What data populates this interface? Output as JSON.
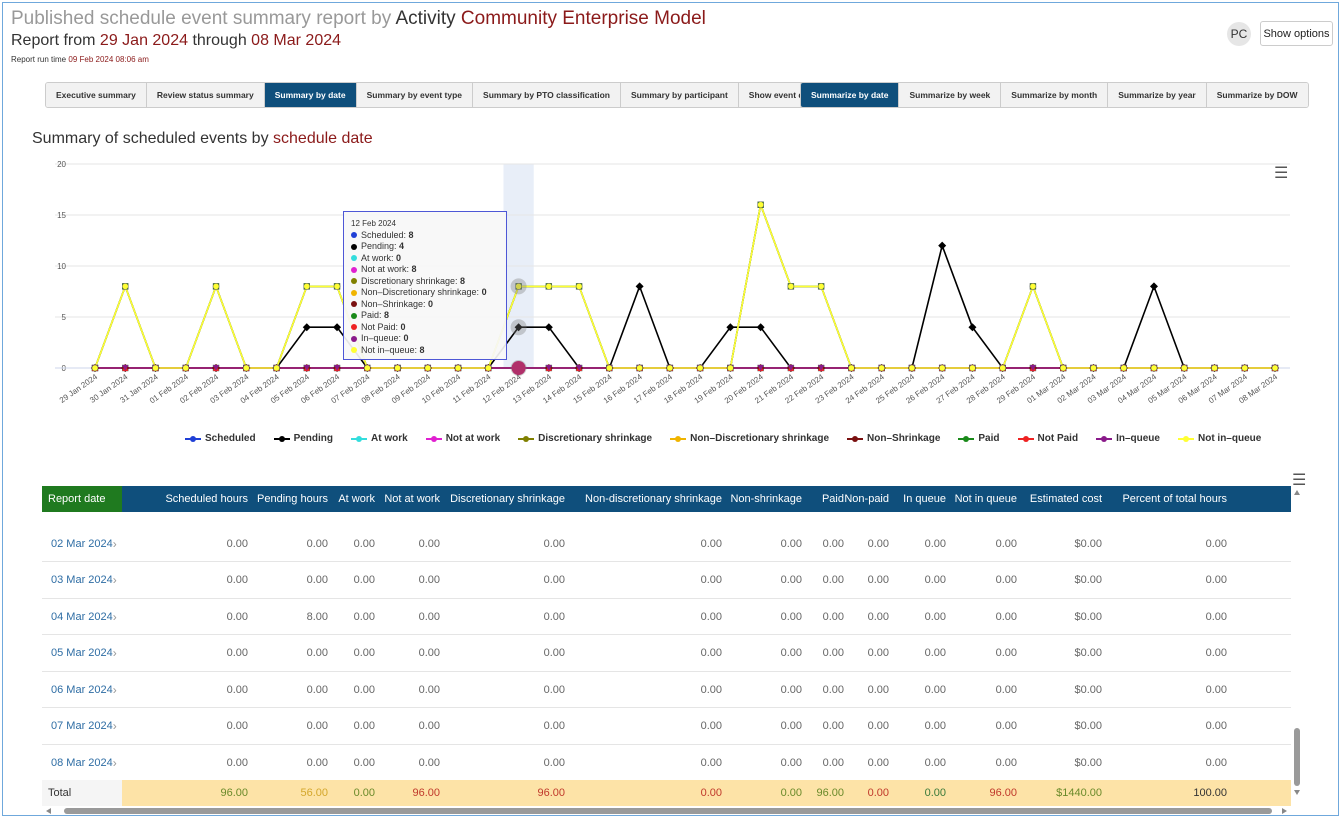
{
  "header": {
    "title_prefix": "Published schedule event summary report by",
    "title_mid": "Activity",
    "title_entity": "Community Enterprise Model",
    "sub_prefix": "Report from",
    "date_from": "29 Jan 2024",
    "sub_mid": "through",
    "date_to": "08 Mar 2024",
    "run_label": "Report run time",
    "run_time": "09 Feb 2024 08:06 am",
    "avatar": "PC",
    "show_options": "Show options"
  },
  "tabs_left": [
    {
      "label": "Executive summary",
      "active": false
    },
    {
      "label": "Review status summary",
      "active": false
    },
    {
      "label": "Summary by date",
      "active": true
    },
    {
      "label": "Summary by event type",
      "active": false
    },
    {
      "label": "Summary by PTO classification",
      "active": false
    },
    {
      "label": "Summary by participant",
      "active": false
    },
    {
      "label": "Show event details",
      "active": false
    }
  ],
  "tabs_right": [
    {
      "label": "Summarize by date",
      "active": true
    },
    {
      "label": "Summarize by week",
      "active": false
    },
    {
      "label": "Summarize by month",
      "active": false
    },
    {
      "label": "Summarize by year",
      "active": false
    },
    {
      "label": "Summarize by DOW",
      "active": false
    }
  ],
  "chart_title_prefix": "Summary of scheduled events by",
  "chart_title_key": "schedule date",
  "chart_data": {
    "type": "line",
    "x": [
      "29 Jan 2024",
      "30 Jan 2024",
      "31 Jan 2024",
      "01 Feb 2024",
      "02 Feb 2024",
      "03 Feb 2024",
      "04 Feb 2024",
      "05 Feb 2024",
      "06 Feb 2024",
      "07 Feb 2024",
      "08 Feb 2024",
      "09 Feb 2024",
      "10 Feb 2024",
      "11 Feb 2024",
      "12 Feb 2024",
      "13 Feb 2024",
      "14 Feb 2024",
      "15 Feb 2024",
      "16 Feb 2024",
      "17 Feb 2024",
      "18 Feb 2024",
      "19 Feb 2024",
      "20 Feb 2024",
      "21 Feb 2024",
      "22 Feb 2024",
      "23 Feb 2024",
      "24 Feb 2024",
      "25 Feb 2024",
      "26 Feb 2024",
      "27 Feb 2024",
      "28 Feb 2024",
      "29 Feb 2024",
      "01 Mar 2024",
      "02 Mar 2024",
      "03 Mar 2024",
      "04 Mar 2024",
      "05 Mar 2024",
      "06 Mar 2024",
      "07 Mar 2024",
      "08 Mar 2024"
    ],
    "ylim": [
      0,
      20
    ],
    "yticks": [
      0,
      5,
      10,
      15,
      20
    ],
    "grid": true,
    "legend_position": "bottom",
    "series": [
      {
        "name": "Scheduled",
        "color": "#1f3fd6",
        "marker": "circle",
        "values": [
          0,
          0,
          0,
          0,
          0,
          0,
          0,
          0,
          0,
          0,
          0,
          0,
          0,
          0,
          0,
          0,
          0,
          0,
          0,
          0,
          0,
          0,
          0,
          0,
          0,
          0,
          0,
          0,
          0,
          0,
          0,
          0,
          0,
          0,
          0,
          0,
          0,
          0,
          0,
          0
        ]
      },
      {
        "name": "Pending",
        "color": "#000000",
        "marker": "diamond",
        "values": [
          0,
          0,
          0,
          0,
          0,
          0,
          0,
          4,
          4,
          0,
          0,
          0,
          0,
          0,
          4,
          4,
          0,
          0,
          8,
          0,
          0,
          4,
          4,
          0,
          0,
          0,
          0,
          0,
          12,
          4,
          0,
          0,
          0,
          0,
          0,
          8,
          0,
          0,
          0,
          0
        ]
      },
      {
        "name": "At work",
        "color": "#33dddd",
        "marker": "square",
        "values": [
          0,
          0,
          0,
          0,
          0,
          0,
          0,
          0,
          0,
          0,
          0,
          0,
          0,
          0,
          0,
          0,
          0,
          0,
          0,
          0,
          0,
          0,
          0,
          0,
          0,
          0,
          0,
          0,
          0,
          0,
          0,
          0,
          0,
          0,
          0,
          0,
          0,
          0,
          0,
          0
        ]
      },
      {
        "name": "Not at work",
        "color": "#e020d0",
        "marker": "triangle",
        "values": [
          0,
          8,
          0,
          0,
          8,
          0,
          0,
          8,
          8,
          0,
          0,
          0,
          0,
          0,
          8,
          8,
          8,
          0,
          0,
          0,
          0,
          0,
          16,
          8,
          8,
          0,
          0,
          0,
          0,
          0,
          0,
          8,
          0,
          0,
          0,
          0,
          0,
          0,
          0,
          0
        ]
      },
      {
        "name": "Discretionary shrinkage",
        "color": "#808000",
        "marker": "triangle-down",
        "values": [
          0,
          8,
          0,
          0,
          8,
          0,
          0,
          8,
          8,
          0,
          0,
          0,
          0,
          0,
          8,
          8,
          8,
          0,
          0,
          0,
          0,
          0,
          16,
          8,
          8,
          0,
          0,
          0,
          0,
          0,
          0,
          8,
          0,
          0,
          0,
          0,
          0,
          0,
          0,
          0
        ]
      },
      {
        "name": "Non–Discretionary shrinkage",
        "color": "#f0b400",
        "marker": "circle",
        "values": [
          0,
          0,
          0,
          0,
          0,
          0,
          0,
          0,
          0,
          0,
          0,
          0,
          0,
          0,
          0,
          0,
          0,
          0,
          0,
          0,
          0,
          0,
          0,
          0,
          0,
          0,
          0,
          0,
          0,
          0,
          0,
          0,
          0,
          0,
          0,
          0,
          0,
          0,
          0,
          0
        ]
      },
      {
        "name": "Non–Shrinkage",
        "color": "#7a1010",
        "marker": "diamond",
        "values": [
          0,
          0,
          0,
          0,
          0,
          0,
          0,
          0,
          0,
          0,
          0,
          0,
          0,
          0,
          0,
          0,
          0,
          0,
          0,
          0,
          0,
          0,
          0,
          0,
          0,
          0,
          0,
          0,
          0,
          0,
          0,
          0,
          0,
          0,
          0,
          0,
          0,
          0,
          0,
          0
        ]
      },
      {
        "name": "Paid",
        "color": "#1a8a1a",
        "marker": "square",
        "values": [
          0,
          8,
          0,
          0,
          8,
          0,
          0,
          8,
          8,
          0,
          0,
          0,
          0,
          0,
          8,
          8,
          8,
          0,
          0,
          0,
          0,
          0,
          16,
          8,
          8,
          0,
          0,
          0,
          0,
          0,
          0,
          8,
          0,
          0,
          0,
          0,
          0,
          0,
          0,
          0
        ]
      },
      {
        "name": "Not Paid",
        "color": "#ee2222",
        "marker": "triangle",
        "values": [
          0,
          0,
          0,
          0,
          0,
          0,
          0,
          0,
          0,
          0,
          0,
          0,
          0,
          0,
          0,
          0,
          0,
          0,
          0,
          0,
          0,
          0,
          0,
          0,
          0,
          0,
          0,
          0,
          0,
          0,
          0,
          0,
          0,
          0,
          0,
          0,
          0,
          0,
          0,
          0
        ]
      },
      {
        "name": "In–queue",
        "color": "#8a1a8a",
        "marker": "triangle-down",
        "values": [
          0,
          0,
          0,
          0,
          0,
          0,
          0,
          0,
          0,
          0,
          0,
          0,
          0,
          0,
          0,
          0,
          0,
          0,
          0,
          0,
          0,
          0,
          0,
          0,
          0,
          0,
          0,
          0,
          0,
          0,
          0,
          0,
          0,
          0,
          0,
          0,
          0,
          0,
          0,
          0
        ]
      },
      {
        "name": "Not in–queue",
        "color": "#ffff33",
        "marker": "circle",
        "values": [
          0,
          8,
          0,
          0,
          8,
          0,
          0,
          8,
          8,
          0,
          0,
          0,
          0,
          0,
          8,
          8,
          8,
          0,
          0,
          0,
          0,
          0,
          16,
          8,
          8,
          0,
          0,
          0,
          0,
          0,
          0,
          8,
          0,
          0,
          0,
          0,
          0,
          0,
          0,
          0
        ]
      }
    ]
  },
  "tooltip": {
    "date": "12 Feb 2024",
    "items": [
      {
        "label": "Scheduled:",
        "value": "8",
        "color": "#1f3fd6"
      },
      {
        "label": "Pending:",
        "value": "4",
        "color": "#000000"
      },
      {
        "label": "At work:",
        "value": "0",
        "color": "#33dddd"
      },
      {
        "label": "Not at work:",
        "value": "8",
        "color": "#e020d0"
      },
      {
        "label": "Discretionary shrinkage:",
        "value": "8",
        "color": "#808000"
      },
      {
        "label": "Non–Discretionary shrinkage:",
        "value": "0",
        "color": "#f0b400"
      },
      {
        "label": "Non–Shrinkage:",
        "value": "0",
        "color": "#7a1010"
      },
      {
        "label": "Paid:",
        "value": "8",
        "color": "#1a8a1a"
      },
      {
        "label": "Not Paid:",
        "value": "0",
        "color": "#ee2222"
      },
      {
        "label": "In–queue:",
        "value": "0",
        "color": "#8a1a8a"
      },
      {
        "label": "Not in–queue:",
        "value": "8",
        "color": "#ffff33"
      }
    ]
  },
  "table": {
    "columns": [
      "Report date",
      "Scheduled hours",
      "Pending hours",
      "At work",
      "Not at work",
      "Discretionary shrinkage",
      "Non-discretionary shrinkage",
      "Non-shrinkage",
      "Paid",
      "Non-paid",
      "In queue",
      "Not in queue",
      "Estimated cost",
      "Percent of total hours"
    ],
    "rows": [
      [
        "02 Mar 2024",
        "0.00",
        "0.00",
        "0.00",
        "0.00",
        "0.00",
        "0.00",
        "0.00",
        "0.00",
        "0.00",
        "0.00",
        "0.00",
        "$0.00",
        "0.00"
      ],
      [
        "03 Mar 2024",
        "0.00",
        "0.00",
        "0.00",
        "0.00",
        "0.00",
        "0.00",
        "0.00",
        "0.00",
        "0.00",
        "0.00",
        "0.00",
        "$0.00",
        "0.00"
      ],
      [
        "04 Mar 2024",
        "0.00",
        "8.00",
        "0.00",
        "0.00",
        "0.00",
        "0.00",
        "0.00",
        "0.00",
        "0.00",
        "0.00",
        "0.00",
        "$0.00",
        "0.00"
      ],
      [
        "05 Mar 2024",
        "0.00",
        "0.00",
        "0.00",
        "0.00",
        "0.00",
        "0.00",
        "0.00",
        "0.00",
        "0.00",
        "0.00",
        "0.00",
        "$0.00",
        "0.00"
      ],
      [
        "06 Mar 2024",
        "0.00",
        "0.00",
        "0.00",
        "0.00",
        "0.00",
        "0.00",
        "0.00",
        "0.00",
        "0.00",
        "0.00",
        "0.00",
        "$0.00",
        "0.00"
      ],
      [
        "07 Mar 2024",
        "0.00",
        "0.00",
        "0.00",
        "0.00",
        "0.00",
        "0.00",
        "0.00",
        "0.00",
        "0.00",
        "0.00",
        "0.00",
        "$0.00",
        "0.00"
      ],
      [
        "08 Mar 2024",
        "0.00",
        "0.00",
        "0.00",
        "0.00",
        "0.00",
        "0.00",
        "0.00",
        "0.00",
        "0.00",
        "0.00",
        "0.00",
        "$0.00",
        "0.00"
      ]
    ],
    "total": [
      "Total",
      "96.00",
      "56.00",
      "0.00",
      "96.00",
      "96.00",
      "0.00",
      "0.00",
      "96.00",
      "0.00",
      "0.00",
      "96.00",
      "$1440.00",
      "100.00"
    ]
  }
}
